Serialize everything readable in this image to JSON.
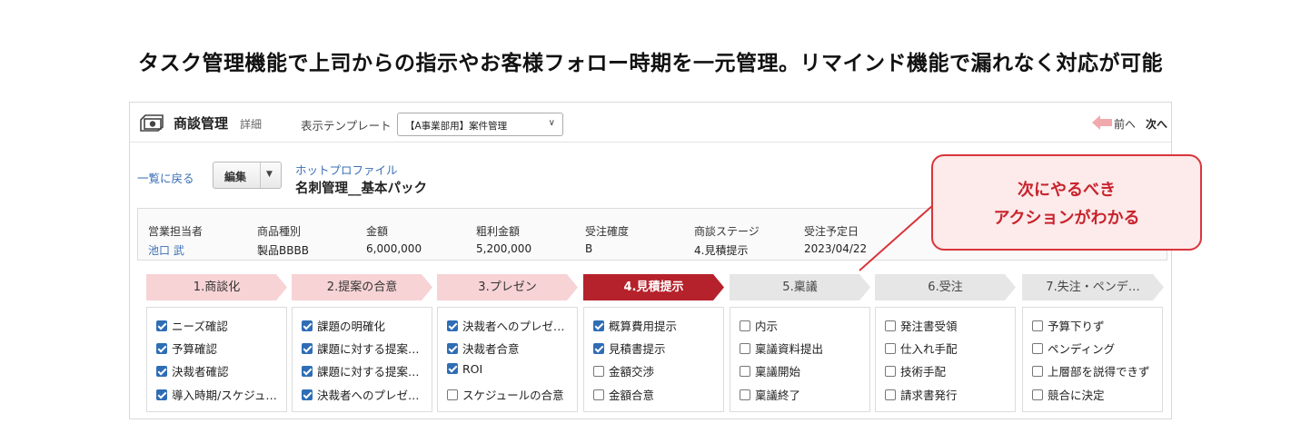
{
  "headline": "タスク管理機能で上司からの指示やお客様フォロー時期を一元管理。リマインド機能で漏れなく対応が可能",
  "app": {
    "title": "商談管理",
    "subtitle": "詳細",
    "icon": "money-icon"
  },
  "template": {
    "label": "表示テンプレート",
    "selected": "【A事業部用】案件管理"
  },
  "nav": {
    "prev": "前へ",
    "next": "次へ"
  },
  "record": {
    "back_link": "一覧に戻る",
    "edit_button": "編集",
    "type": "ホットプロファイル",
    "name": "名刺管理__基本パック"
  },
  "info_fields": [
    {
      "label": "営業担当者",
      "value": "池口 武"
    },
    {
      "label": "商品種別",
      "value": "製品BBBB"
    },
    {
      "label": "金額",
      "value": "6,000,000"
    },
    {
      "label": "粗利金額",
      "value": "5,200,000"
    },
    {
      "label": "受注確度",
      "value": "B"
    },
    {
      "label": "商談ステージ",
      "value": "4.見積提示"
    },
    {
      "label": "受注予定日",
      "value": "2023/04/22"
    }
  ],
  "stages": [
    {
      "label": "1.商談化",
      "state": "done"
    },
    {
      "label": "2.提案の合意",
      "state": "done"
    },
    {
      "label": "3.プレゼン",
      "state": "done"
    },
    {
      "label": "4.見積提示",
      "state": "current"
    },
    {
      "label": "5.稟議",
      "state": "todo"
    },
    {
      "label": "6.受注",
      "state": "todo"
    },
    {
      "label": "7.失注・ペンデ…",
      "state": "todo"
    }
  ],
  "task_columns": [
    [
      {
        "label": "ニーズ確認",
        "checked": true
      },
      {
        "label": "予算確認",
        "checked": true
      },
      {
        "label": "決裁者確認",
        "checked": true
      },
      {
        "label": "導入時期/スケジュ…",
        "checked": true
      }
    ],
    [
      {
        "label": "課題の明確化",
        "checked": true
      },
      {
        "label": "課題に対する提案…",
        "checked": true
      },
      {
        "label": "課題に対する提案…",
        "checked": true
      },
      {
        "label": "決裁者へのプレゼ…",
        "checked": true
      }
    ],
    [
      {
        "label": "決裁者へのプレゼ…",
        "checked": true
      },
      {
        "label": "決裁者合意",
        "checked": true
      },
      {
        "label": "ROI",
        "checked": true
      },
      {
        "label": "スケジュールの合意",
        "checked": false
      }
    ],
    [
      {
        "label": "概算費用提示",
        "checked": true
      },
      {
        "label": "見積書提示",
        "checked": true
      },
      {
        "label": "金額交渉",
        "checked": false
      },
      {
        "label": "金額合意",
        "checked": false
      }
    ],
    [
      {
        "label": "内示",
        "checked": false
      },
      {
        "label": "稟議資料提出",
        "checked": false
      },
      {
        "label": "稟議開始",
        "checked": false
      },
      {
        "label": "稟議終了",
        "checked": false
      }
    ],
    [
      {
        "label": "発注書受領",
        "checked": false
      },
      {
        "label": "仕入れ手配",
        "checked": false
      },
      {
        "label": "技術手配",
        "checked": false
      },
      {
        "label": "請求書発行",
        "checked": false
      }
    ],
    [
      {
        "label": "予算下りず",
        "checked": false
      },
      {
        "label": "ペンディング",
        "checked": false
      },
      {
        "label": "上層部を説得できず",
        "checked": false
      },
      {
        "label": "競合に決定",
        "checked": false
      }
    ]
  ],
  "callout": {
    "line1": "次にやるべき",
    "line2": "アクションがわかる"
  },
  "colors": {
    "accent_red": "#b5222b",
    "stage_done": "#f7d3d5",
    "stage_todo": "#e6e6e6",
    "checkbox_blue": "#2f6db5",
    "link_blue": "#3a6fb5"
  }
}
